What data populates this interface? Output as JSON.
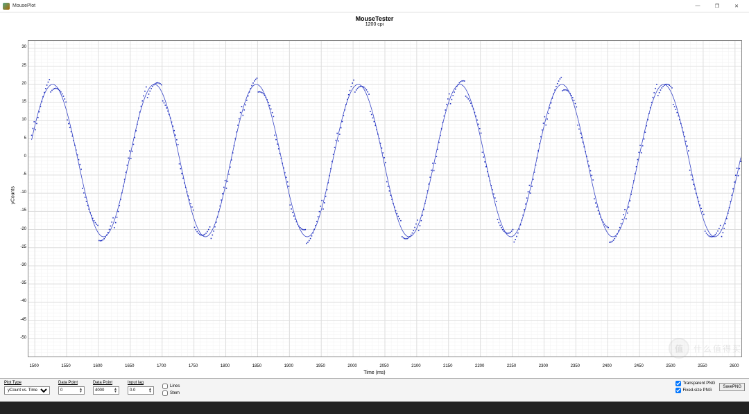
{
  "window": {
    "title": "MousePlot",
    "min": "—",
    "max": "❐",
    "close": "✕"
  },
  "chart_data": {
    "type": "scatter",
    "title": "MouseTester",
    "subtitle": "1200 cpi",
    "xlabel": "Time (ms)",
    "ylabel": "yCounts",
    "xlim": [
      1490,
      2610
    ],
    "ylim": [
      -55,
      32
    ],
    "xticks": [
      1500,
      1550,
      1600,
      1650,
      1700,
      1750,
      1800,
      1850,
      1900,
      1950,
      2000,
      2050,
      2100,
      2150,
      2200,
      2250,
      2300,
      2350,
      2400,
      2450,
      2500,
      2550,
      2600
    ],
    "yticks": [
      -50,
      -45,
      -40,
      -35,
      -30,
      -25,
      -20,
      -15,
      -10,
      -5,
      0,
      5,
      10,
      15,
      20,
      25,
      30
    ],
    "series": [
      {
        "name": "yCount",
        "type": "scatter+line",
        "color": "#2030c0",
        "period_ms": 160,
        "amplitude": 21,
        "offset": -1,
        "noise_counts": 2
      }
    ]
  },
  "controls": {
    "plot_type_label": "Plot Type",
    "plot_type_value": "yCount vs. Time",
    "data_point_label": "Data Point",
    "data_point1": "0",
    "data_point2_label": "Data Point",
    "data_point2": "4000",
    "input_lag_label": "Input lag",
    "input_lag": "0.0",
    "lines_label": "Lines",
    "stem_label": "Stem",
    "transparent_label": "Transparent PNG",
    "fixedsize_label": "Fixed-size PNG",
    "save_label": "SavePNG"
  },
  "watermark": {
    "badge": "值",
    "text": "什么值得买"
  }
}
